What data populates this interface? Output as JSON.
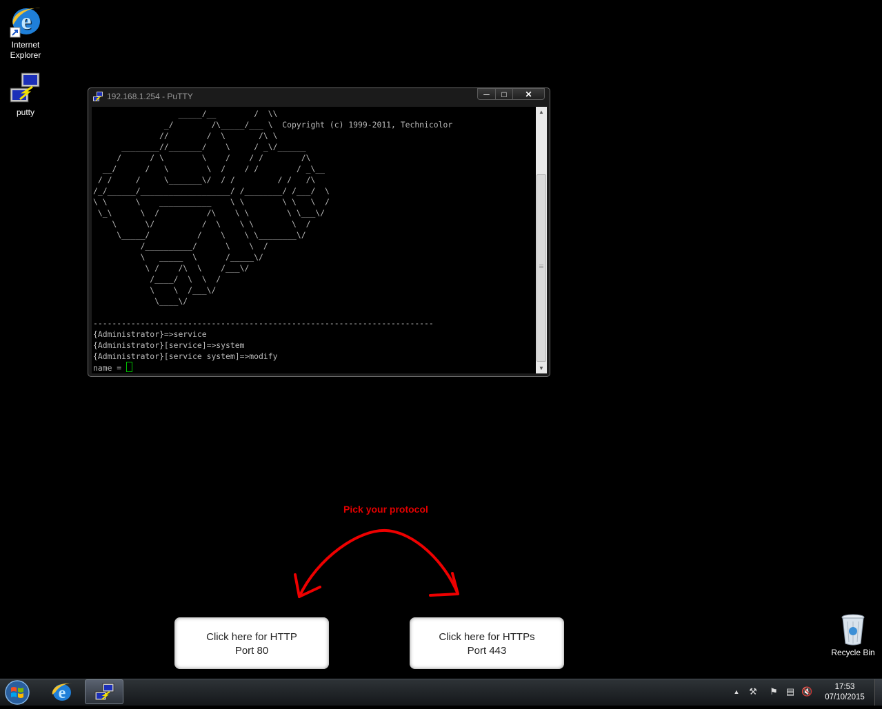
{
  "desktop": {
    "icons": [
      {
        "label_line1": "Internet",
        "label_line2": "Explorer"
      },
      {
        "label_line1": "putty",
        "label_line2": ""
      },
      {
        "label_line1": "Recycle Bin",
        "label_line2": ""
      }
    ]
  },
  "putty": {
    "title": "192.168.1.254 - PuTTY",
    "minimize_icon": "minimize-icon",
    "maximize_icon": "maximize-icon",
    "close_icon": "close-icon",
    "terminal_lines": [
      "                  _____/__        /  \\\\",
      "               _/        /\\_____/___ \\  Copyright (c) 1999-2011, Technicolor",
      "              //        /  \\       /\\ \\",
      "      ________//_______/    \\     / _\\/______",
      "     /      / \\        \\    /    / /        /\\",
      "  __/      /   \\        \\  /    / /        / _\\__",
      " / /     /     \\_______\\/  / /         / /   /\\",
      "/_/______/___________________/ /________/ /___/  \\",
      "\\ \\      \\    ___________    \\ \\        \\ \\   \\  /",
      " \\_\\      \\  /          /\\    \\ \\        \\ \\___\\/",
      "    \\      \\/          /  \\    \\ \\        \\  /",
      "     \\_____/          /    \\    \\ \\________\\/",
      "          /__________/      \\    \\  /",
      "          \\   _____  \\      /_____\\/",
      "           \\ /    /\\  \\    /___\\/",
      "            /____/  \\  \\  /",
      "            \\    \\  /___\\/",
      "             \\____\\/",
      "",
      "------------------------------------------------------------------------",
      "{Administrator}=>service",
      "{Administrator}[service]=>system",
      "{Administrator}[service system]=>modify"
    ],
    "prompt": "name = "
  },
  "annotation": {
    "text": "Pick your protocol",
    "color": "#e50000"
  },
  "buttons": {
    "http": {
      "line1": "Click here for HTTP",
      "line2": "Port 80"
    },
    "https": {
      "line1": "Click here for HTTPs",
      "line2": "Port 443"
    }
  },
  "taskbar": {
    "start_icon": "windows-start-icon",
    "pinned": [
      "internet-explorer-icon",
      "putty-icon"
    ],
    "tray_icons": [
      "show-hidden-icons-arrow",
      "network-tools-icon",
      "action-center-flag-icon",
      "network-icon",
      "volume-muted-icon"
    ],
    "clock_time": "17:53",
    "clock_date": "07/10/2015"
  }
}
